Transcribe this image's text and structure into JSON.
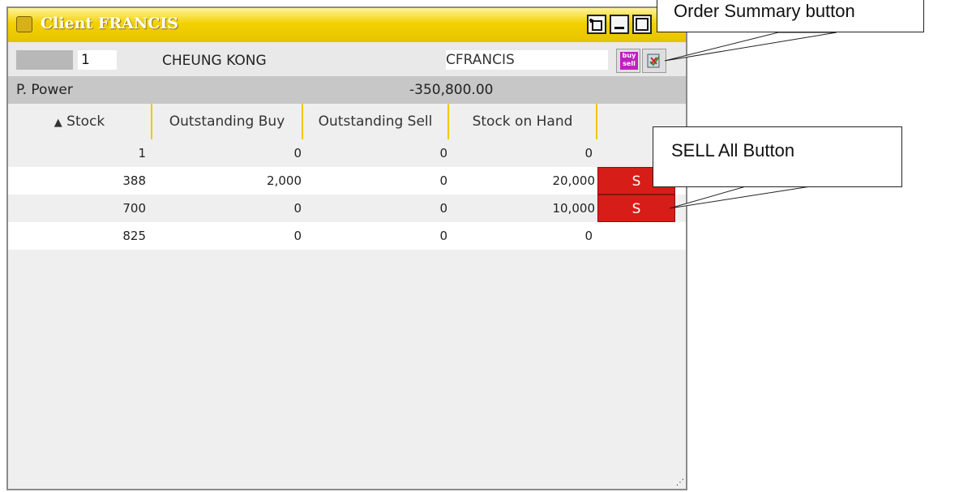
{
  "window": {
    "title": "Client FRANCIS",
    "toolbar": {
      "detach_icon": "detach-icon",
      "minimize_icon": "minimize-icon",
      "maximize_icon": "maximize-icon"
    },
    "header": {
      "input_value": "1",
      "stock_name": "CHEUNG KONG",
      "client_code": "CFRANCIS",
      "buy_sell_icon_text": "buy sell"
    },
    "purchasing_power": {
      "label": "P. Power",
      "value": "-350,800.00"
    },
    "table": {
      "sort_arrow": "▲",
      "columns": [
        "Stock",
        "Outstanding Buy",
        "Outstanding Sell",
        "Stock on Hand"
      ],
      "rows": [
        {
          "stock": "1",
          "outstanding_buy": "0",
          "outstanding_sell": "0",
          "stock_on_hand": "0",
          "sell_label": ""
        },
        {
          "stock": "388",
          "outstanding_buy": "2,000",
          "outstanding_sell": "0",
          "stock_on_hand": "20,000",
          "sell_label": "S"
        },
        {
          "stock": "700",
          "outstanding_buy": "0",
          "outstanding_sell": "0",
          "stock_on_hand": "10,000",
          "sell_label": "S"
        },
        {
          "stock": "825",
          "outstanding_buy": "0",
          "outstanding_sell": "0",
          "stock_on_hand": "0",
          "sell_label": ""
        }
      ]
    }
  },
  "callouts": {
    "order_summary": "Order Summary button",
    "sell_all": "SELL All Button"
  },
  "colors": {
    "title_bar": "#f3d100",
    "sell_button": "#d71d17",
    "header_divider": "#f3c600"
  }
}
